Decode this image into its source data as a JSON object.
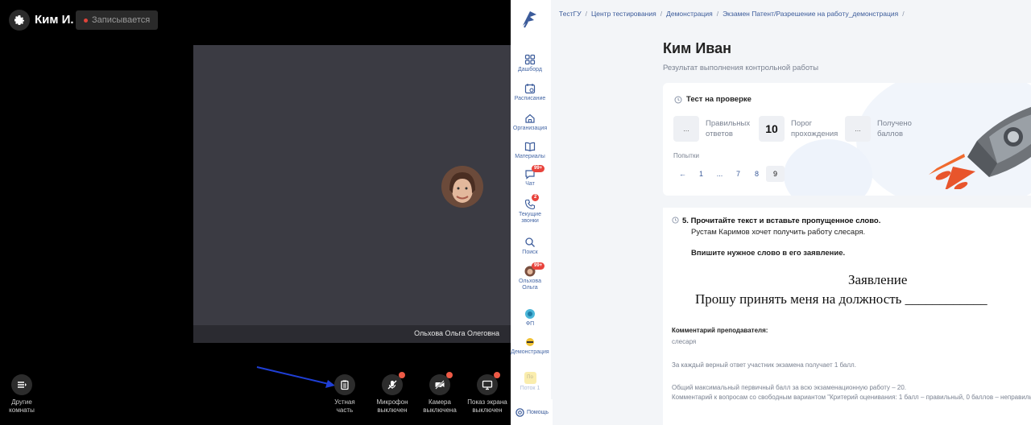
{
  "call": {
    "user_short": "Ким И.",
    "recording_label": "Записывается",
    "participant_name": "Ольхова Ольга Олеговна",
    "rooms_label": "Другие\nкомнаты",
    "controls": [
      {
        "label": "Устная\nчасть",
        "icon": "clipboard-icon",
        "dot": false
      },
      {
        "label": "Микрофон\nвыключен",
        "icon": "mic-off-icon",
        "dot": true
      },
      {
        "label": "Камера\nвыключена",
        "icon": "camera-off-icon",
        "dot": true
      },
      {
        "label": "Показ экрана\nвыключен",
        "icon": "screen-share-icon",
        "dot": true
      }
    ],
    "accent_arrow": "#1f3fd6",
    "alert_dot": "#ee5a46"
  },
  "lms": {
    "breadcrumbs": [
      "ТестГУ",
      "Центр тестирования",
      "Демонстрация",
      "Экзамен Патент/Разрешение на работу_демонстрация"
    ],
    "nav": [
      {
        "label": "Дашборд",
        "icon": "dashboard-icon"
      },
      {
        "label": "Расписание",
        "icon": "calendar-icon"
      },
      {
        "label": "Организация",
        "icon": "home-icon"
      },
      {
        "label": "Материалы",
        "icon": "book-icon"
      },
      {
        "label": "Чат",
        "icon": "chat-icon",
        "badge": "99+"
      },
      {
        "label": "Текущие звонки",
        "icon": "phone-icon",
        "badge": "2"
      },
      {
        "label": "Поиск",
        "icon": "search-icon"
      },
      {
        "label": "Ольхова Ольга",
        "icon": "avatar",
        "badge": "99+"
      },
      {
        "label": "ФП",
        "icon": "org-logo-icon"
      },
      {
        "label": "Демонстрация",
        "icon": "org-logo-icon"
      },
      {
        "label": "Поток 1",
        "icon": "stream-icon",
        "chip": "По"
      }
    ],
    "help_label": "Помощь",
    "student_name": "Ким Иван",
    "subtitle": "Результат выполнения контрольной работы",
    "status_title": "Тест на проверке",
    "stats": [
      {
        "value": "...",
        "label": "Правильных\nответов"
      },
      {
        "value": "10",
        "label": "Порог\nпрохождения"
      },
      {
        "value": "...",
        "label": "Получено\nбаллов"
      }
    ],
    "attempts_label": "Попытки",
    "pager": [
      "←",
      "1",
      "...",
      "7",
      "8",
      "9"
    ],
    "active_page": "9",
    "question": {
      "number": "5.",
      "title": "Прочитайте текст и вставьте пропущенное слово.",
      "line1": "Рустам Каримов хочет получить работу слесаря.",
      "line2": "Впишите нужное слово в его заявление.",
      "statement_title": "Заявление",
      "statement_body": "Прошу принять меня на должность ____________"
    },
    "comment_label": "Комментарий преподавателя:",
    "comment_value": "слесаря",
    "note1": "За каждый верный ответ участник экзамена получает 1 балл.",
    "note2": "Общий максимальный первичный балл за всю экзаменационную работу – 20.",
    "note3": "Комментарий к вопросам со свободным вариантом \"Критерий оценивания: 1 балл – правильный, 0 баллов – неправильный"
  }
}
